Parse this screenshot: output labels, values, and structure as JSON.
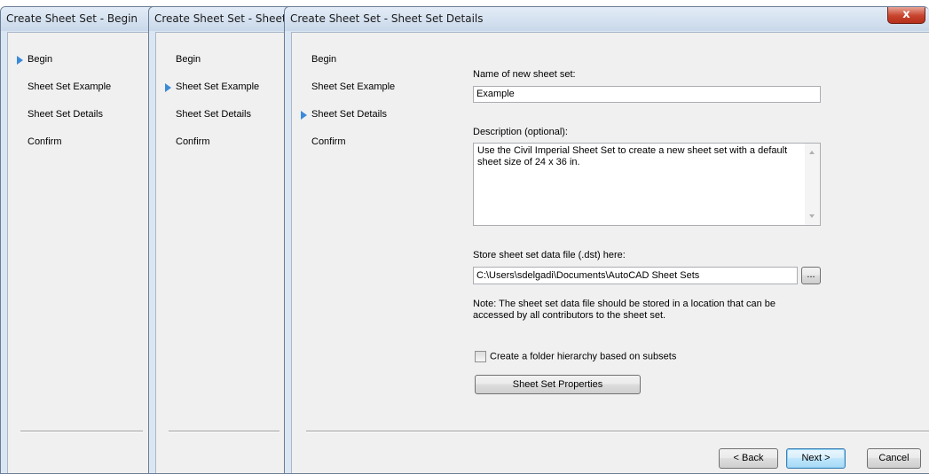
{
  "windows": [
    {
      "title": "Create Sheet Set - Begin",
      "current_step": 0
    },
    {
      "title": "Create Sheet Set - Sheet Set Example",
      "current_step": 1
    },
    {
      "title": "Create Sheet Set - Sheet Set Details",
      "current_step": 2
    }
  ],
  "steps": [
    "Begin",
    "Sheet Set Example",
    "Sheet Set Details",
    "Confirm"
  ],
  "close_label": "x",
  "form": {
    "name_label": "Name of new sheet set:",
    "name_value": "Example",
    "description_label": "Description (optional):",
    "description_value": "Use the Civil Imperial Sheet Set to create a new sheet set with a default sheet size of 24 x 36 in.",
    "store_label": "Store sheet set data file (.dst) here:",
    "store_value": "C:\\Users\\sdelgadi\\Documents\\AutoCAD Sheet Sets",
    "browse_label": "...",
    "note": "Note: The sheet set data file should be stored in a location that can be accessed by all contributors to the sheet set.",
    "checkbox_label": "Create a folder hierarchy based on subsets",
    "checkbox_checked": false,
    "properties_button": "Sheet Set Properties"
  },
  "buttons": {
    "back": "< Back",
    "next": "Next >",
    "cancel": "Cancel"
  }
}
